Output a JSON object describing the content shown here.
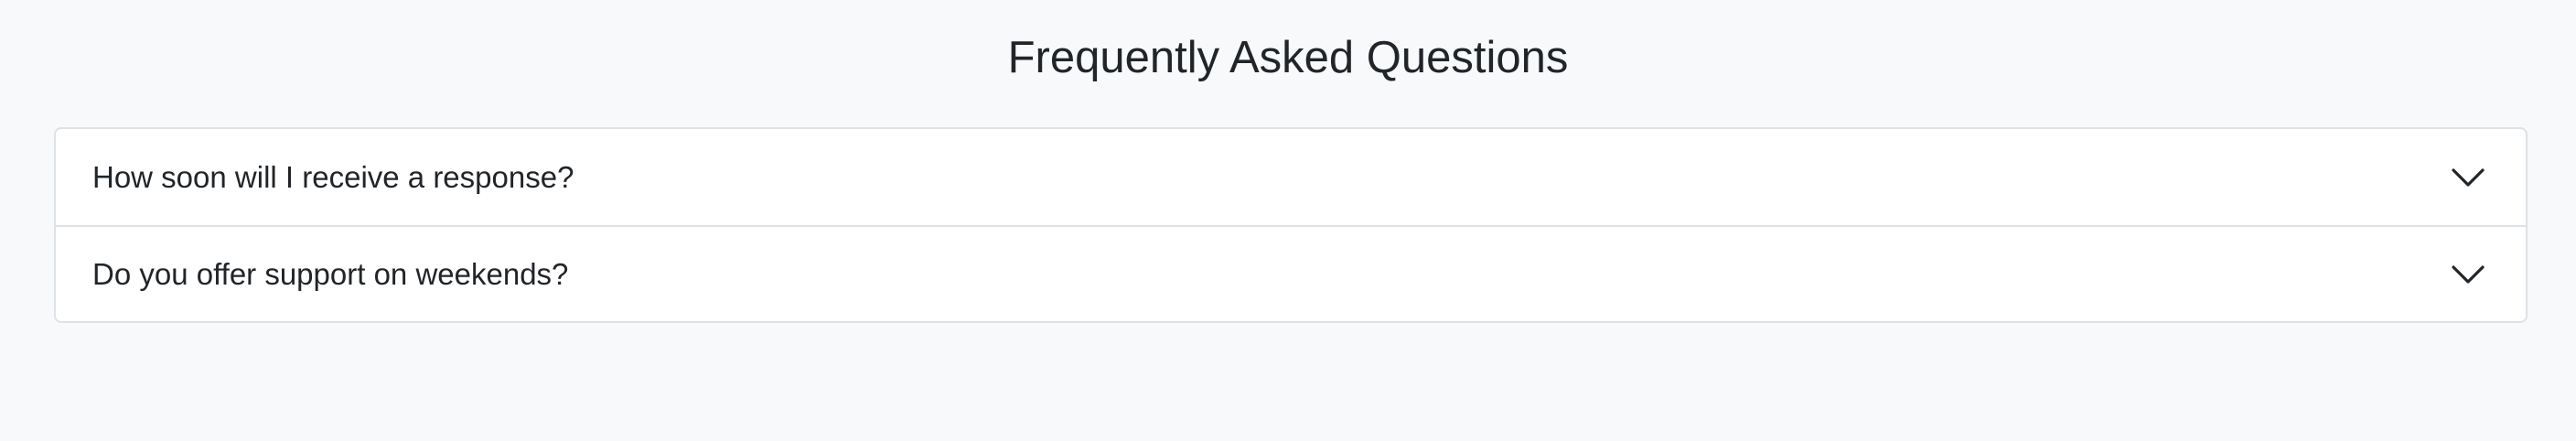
{
  "faq": {
    "title": "Frequently Asked Questions",
    "items": [
      {
        "question": "How soon will I receive a response?",
        "icon": "chevron-down-icon",
        "expanded": false
      },
      {
        "question": "Do you offer support on weekends?",
        "icon": "chevron-down-icon",
        "expanded": false
      }
    ]
  },
  "colors": {
    "background": "#f8f9fa",
    "panel": "#ffffff",
    "border": "#dee2e6",
    "text": "#212529"
  }
}
